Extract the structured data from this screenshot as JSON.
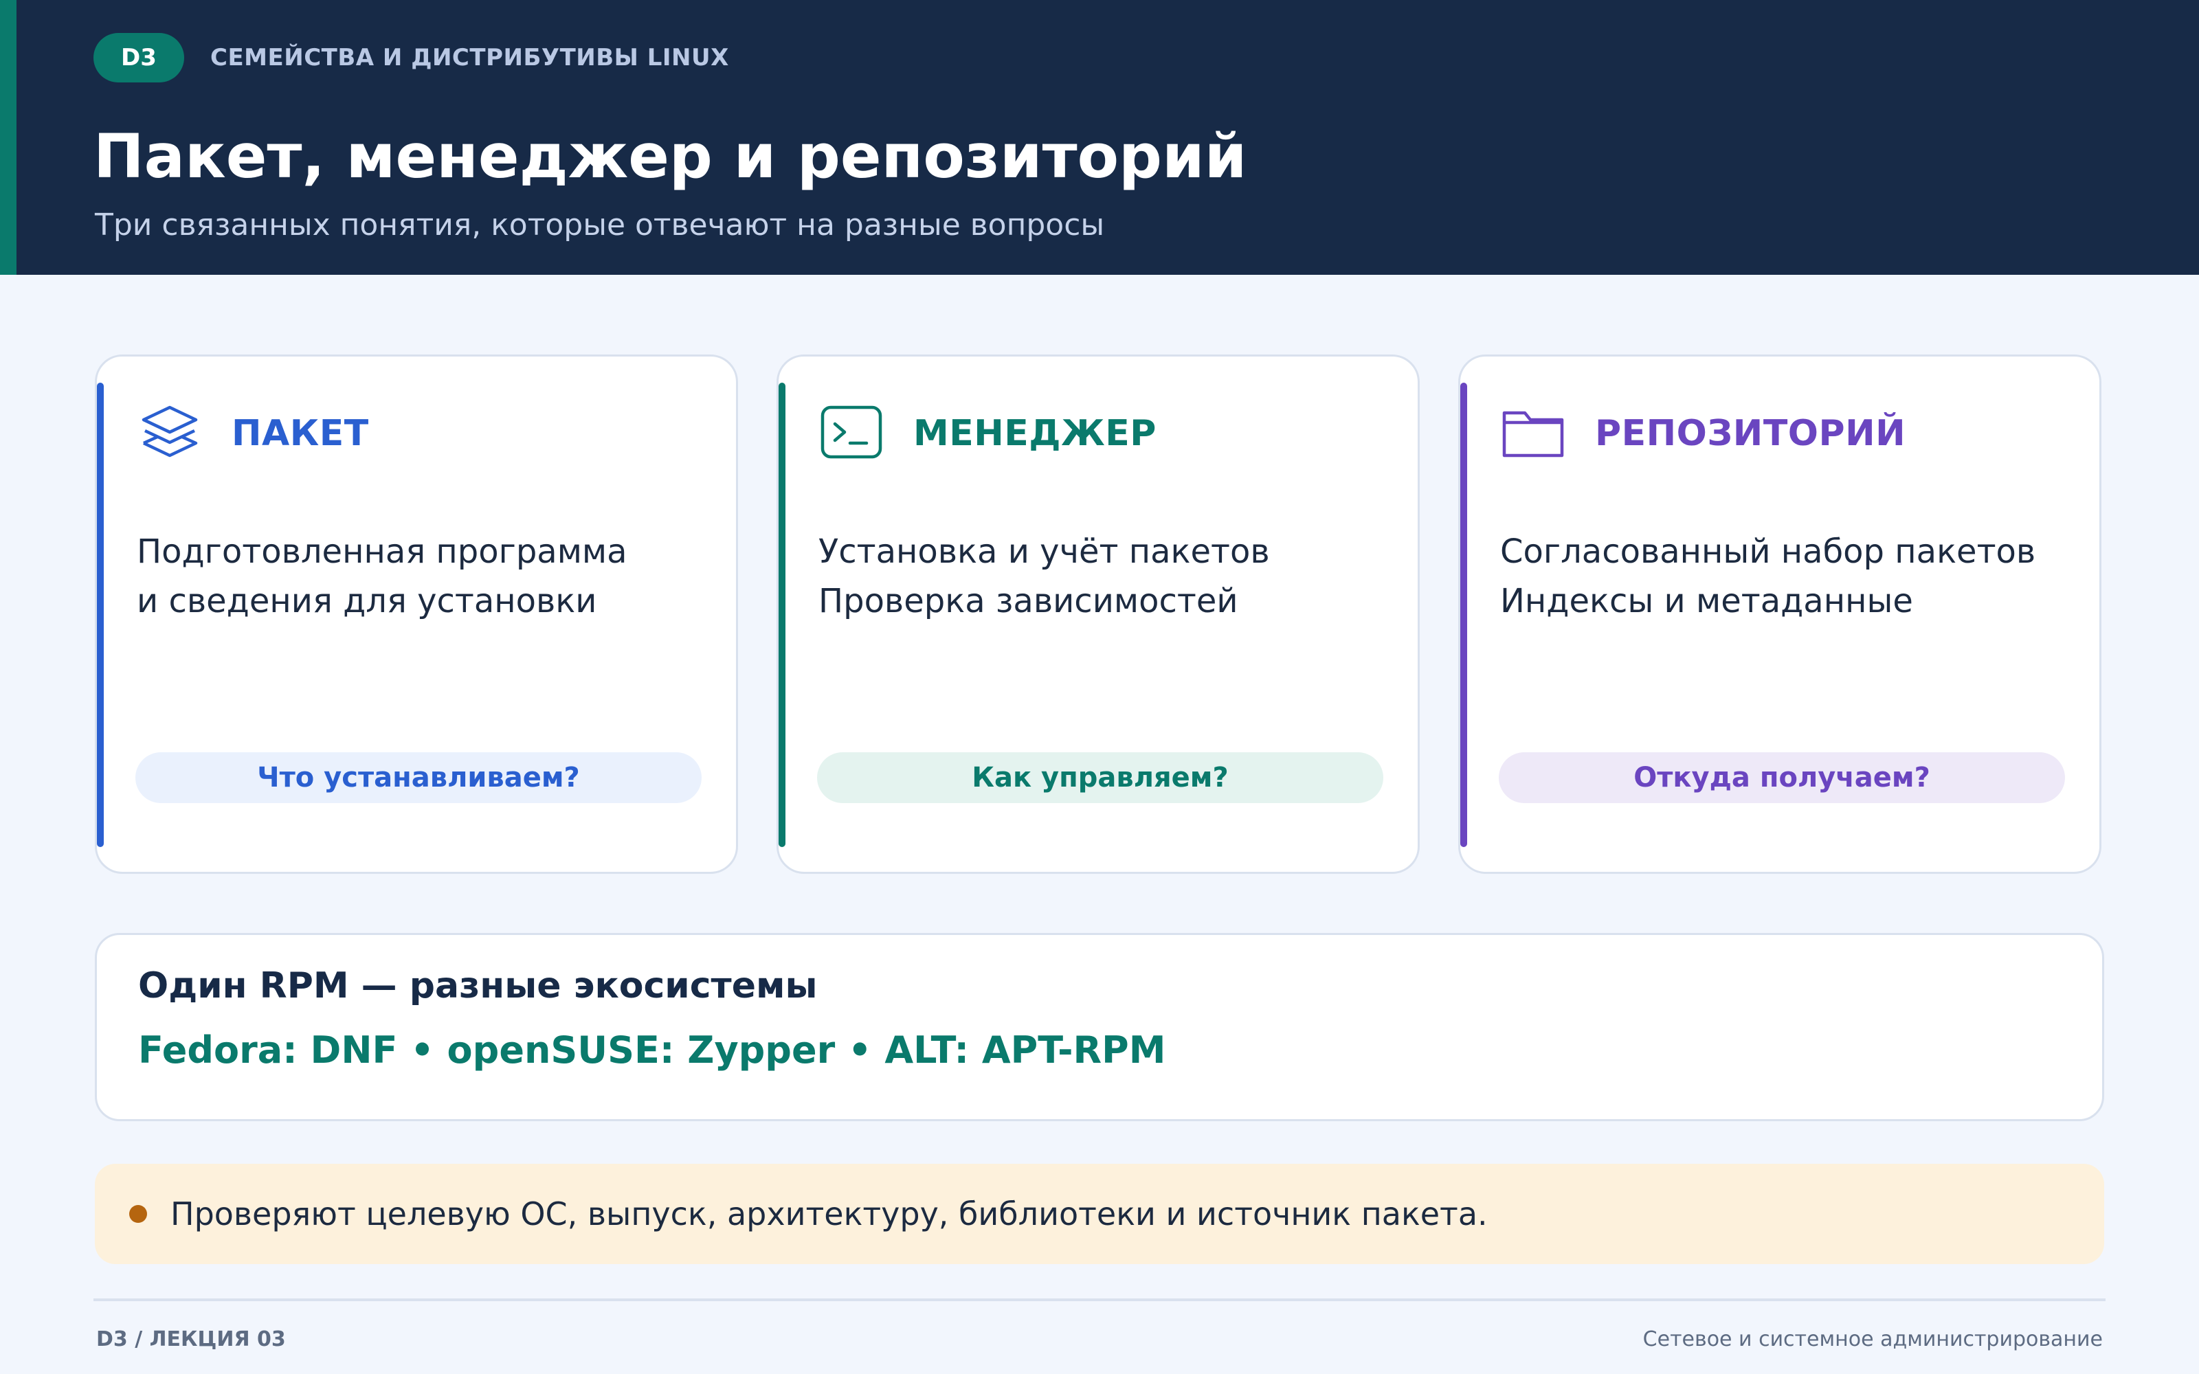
{
  "header": {
    "badge": "D3",
    "kicker": "СЕМЕЙСТВА И ДИСТРИБУТИВЫ LINUX",
    "title": "Пакет, менеджер и репозиторий",
    "subtitle": "Три связанных понятия, которые отвечают на разные вопросы"
  },
  "cards": [
    {
      "icon": "layers-icon",
      "title": "ПАКЕТ",
      "lines": [
        "Подготовленная программа",
        "и сведения для установки"
      ],
      "question": "Что устанавливаем?",
      "color": "#2a5fd0",
      "pill_bg": "#eaf1fd"
    },
    {
      "icon": "terminal-icon",
      "title": "МЕНЕДЖЕР",
      "lines": [
        "Установка и учёт пакетов",
        "Проверка зависимостей"
      ],
      "question": "Как управляем?",
      "color": "#0a7a6c",
      "pill_bg": "#e4f3ef"
    },
    {
      "icon": "folder-icon",
      "title": "РЕПОЗИТОРИЙ",
      "lines": [
        "Согласованный набор пакетов",
        "Индексы и метаданные"
      ],
      "question": "Откуда получаем?",
      "color": "#6a45c0",
      "pill_bg": "#eee9f8"
    }
  ],
  "ecosystems": {
    "title": "Один RPM — разные экосистемы",
    "list": "Fedora: DNF • openSUSE: Zypper • ALT: APT-RPM"
  },
  "note": {
    "text": "Проверяют целевую ОС, выпуск, архитектуру, библиотеки и источник пакета."
  },
  "footer": {
    "left": "D3 / ЛЕКЦИЯ 03",
    "right": "Сетевое и системное администрирование"
  }
}
